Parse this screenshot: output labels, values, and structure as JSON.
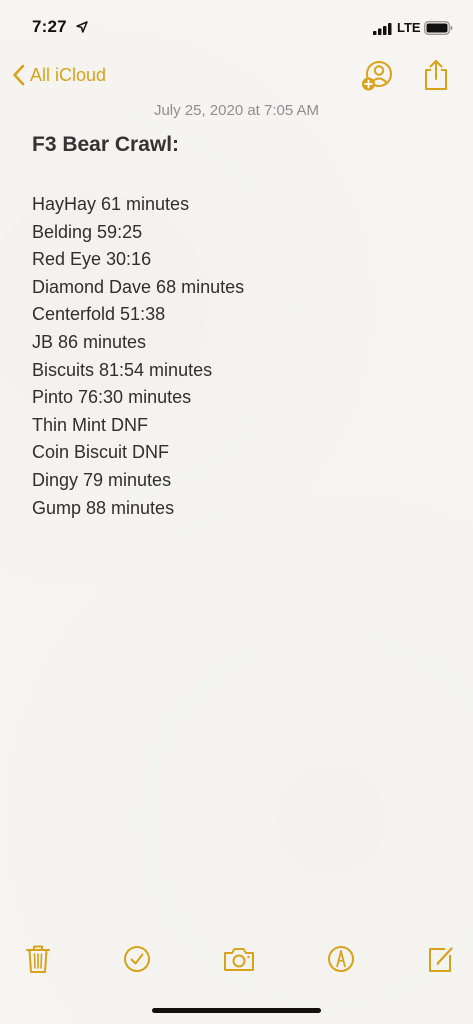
{
  "status_bar": {
    "time": "7:27",
    "network": "LTE",
    "icons": [
      "location-arrow-icon",
      "signal-bars-icon",
      "battery-icon"
    ]
  },
  "nav": {
    "back_label": "All iCloud",
    "icons": [
      "chevron-left-icon",
      "add-person-icon",
      "share-icon"
    ],
    "accent_color": "#d9a21b"
  },
  "note": {
    "date": "July 25, 2020 at 7:05 AM",
    "title": "F3 Bear Crawl:",
    "lines": [
      "HayHay 61 minutes",
      "Belding 59:25",
      "Red Eye 30:16",
      "Diamond Dave 68 minutes",
      "Centerfold 51:38",
      "JB 86 minutes",
      "Biscuits 81:54 minutes",
      "Pinto 76:30 minutes",
      "Thin Mint DNF",
      "Coin Biscuit DNF",
      "Dingy 79 minutes",
      "Gump 88 minutes"
    ]
  },
  "toolbar": {
    "icons": [
      "trash-icon",
      "checklist-icon",
      "camera-icon",
      "markup-icon",
      "compose-icon"
    ]
  }
}
